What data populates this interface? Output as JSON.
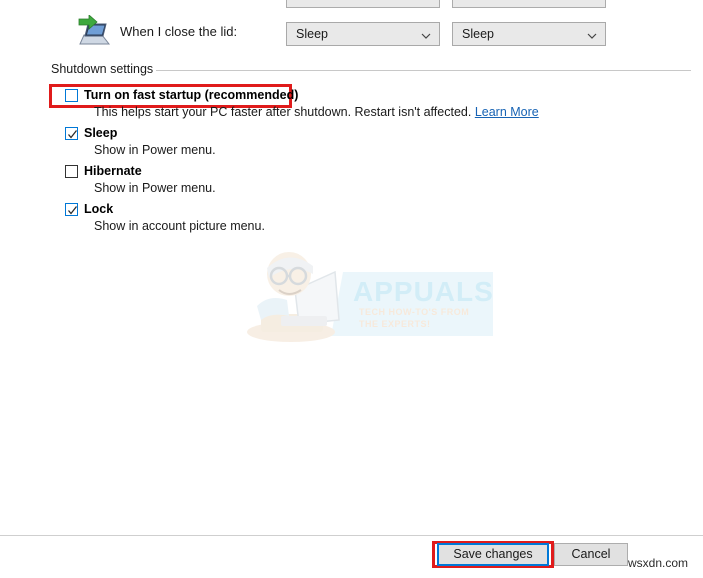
{
  "power_options": {
    "lid_row": {
      "label": "When I close the lid:",
      "icon": "laptop-lid-icon",
      "battery_value": "Sleep",
      "plugged_value": "Sleep"
    },
    "section": {
      "header": "Shutdown settings"
    },
    "settings": [
      {
        "id": "fast-startup",
        "title": "Turn on fast startup (recommended)",
        "description": "This helps start your PC faster after shutdown. Restart isn't affected.",
        "link_text": "Learn More",
        "checked": false,
        "annotated": true
      },
      {
        "id": "sleep",
        "title": "Sleep",
        "description": "Show in Power menu.",
        "checked": true,
        "annotated": false
      },
      {
        "id": "hibernate",
        "title": "Hibernate",
        "description": "Show in Power menu.",
        "checked": false,
        "annotated": false
      },
      {
        "id": "lock",
        "title": "Lock",
        "description": "Show in account picture menu.",
        "checked": true,
        "annotated": false
      }
    ],
    "buttons": {
      "save": "Save changes",
      "cancel": "Cancel"
    }
  },
  "watermarks": {
    "appuals_main": "APPUALS",
    "appuals_sub": "TECH HOW-TO'S FROM THE EXPERTS!",
    "site": "wsxdn.com"
  },
  "colors": {
    "annotation_red": "#e01b1b",
    "focus_blue": "#0078d7",
    "link_blue": "#1763b4",
    "dropdown_bg": "#e9e9e9",
    "button_bg": "#e1e1e1",
    "divider": "#cfcfcf"
  }
}
